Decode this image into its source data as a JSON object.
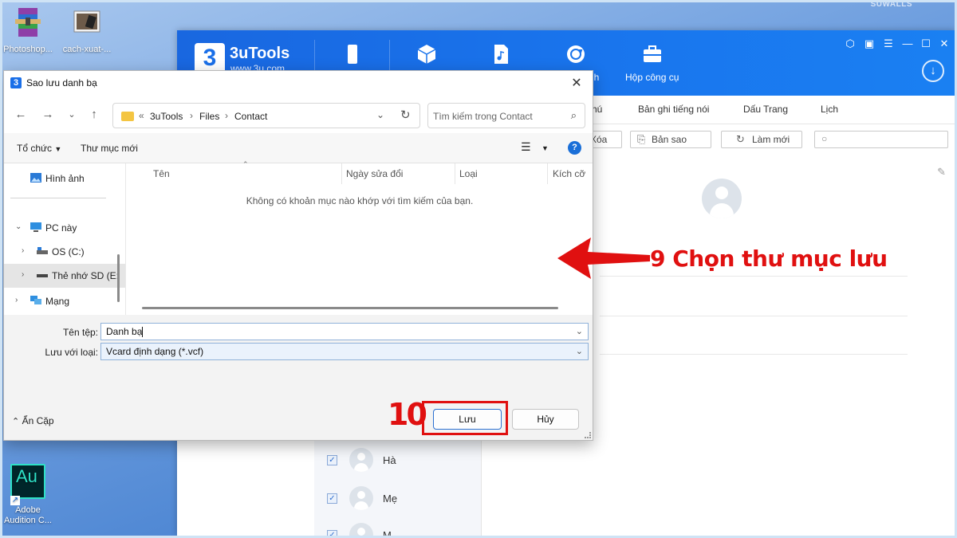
{
  "desktop": {
    "watermark": "SUWALLS",
    "icons": [
      {
        "label": "Photoshop..."
      },
      {
        "label": "cach-xuat-..."
      },
      {
        "label": "Adobe Audition C...",
        "glyph": "Au"
      }
    ]
  },
  "app": {
    "name": "3uTools",
    "url": "www.3u.com",
    "nav": [
      {
        "icon": "phone-icon",
        "label": ""
      },
      {
        "icon": "cube-icon",
        "label": ""
      },
      {
        "icon": "music-file-icon",
        "label": ""
      },
      {
        "icon": "sync-icon",
        "label": "nh"
      },
      {
        "icon": "toolbox-icon",
        "label": "Hộp công cụ"
      }
    ],
    "tabs": [
      "hú",
      "Bản ghi tiếng nói",
      "Dấu Trang",
      "Lịch"
    ],
    "toolbar": {
      "delete": "Xóa",
      "copy": "Bản sao",
      "refresh": "Làm mới"
    },
    "contacts": [
      {
        "name": "Hà",
        "checked": true
      },
      {
        "name": "Mẹ",
        "checked": true
      },
      {
        "name": "M...",
        "checked": true
      }
    ]
  },
  "dialog": {
    "logo": "3",
    "title": "Sao lưu danh bạ",
    "close": "✕",
    "path": {
      "prefix": "«",
      "segments": [
        "3uTools",
        "Files",
        "Contact"
      ]
    },
    "search_placeholder": "Tìm kiếm trong Contact",
    "commands": {
      "organize": "Tổ chức",
      "new_folder": "Thư mục mới"
    },
    "tree": [
      {
        "label": "Hình ảnh",
        "icon": "pictures-icon"
      },
      {
        "label": "PC này",
        "icon": "pc-icon"
      },
      {
        "label": "OS (C:)",
        "icon": "drive-icon"
      },
      {
        "label": "Thẻ nhớ SD (E:",
        "icon": "sd-card-icon"
      },
      {
        "label": "Mạng",
        "icon": "network-icon"
      }
    ],
    "columns": [
      "Tên",
      "Ngày sửa đổi",
      "Loại",
      "Kích cỡ"
    ],
    "empty_message": "Không có khoản mục nào khớp với tìm kiếm của bạn.",
    "filename_label": "Tên tệp:",
    "filename_value": "Danh bạ",
    "filetype_label": "Lưu với loại:",
    "filetype_value": "Vcard định dạng (*.vcf)",
    "hide_folders": "Ẩn Cặp",
    "save_button": "Lưu",
    "cancel_button": "Hủy"
  },
  "annotations": {
    "step9": "9 Chọn thư mục lưu",
    "step10": "10",
    "color": "#e01010"
  }
}
